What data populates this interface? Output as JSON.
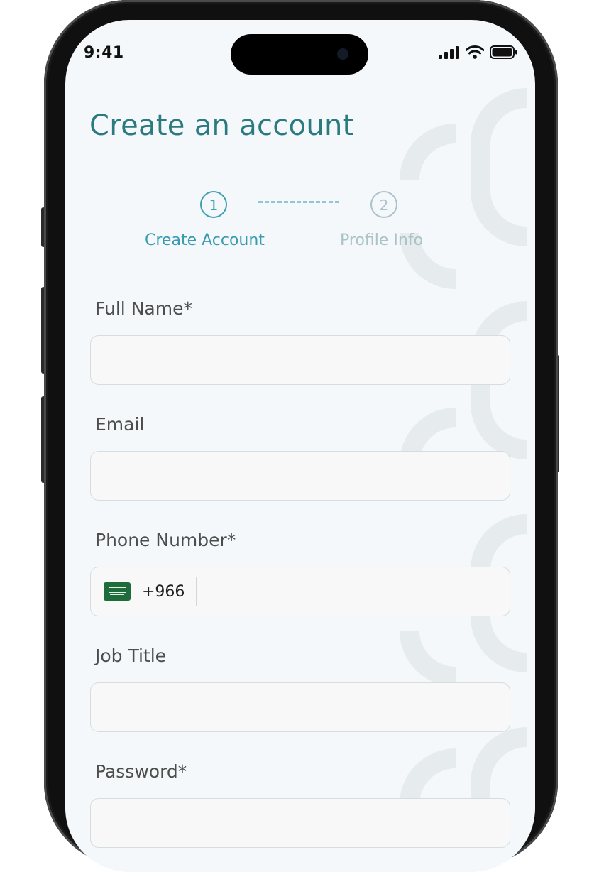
{
  "status_bar": {
    "time": "9:41"
  },
  "page": {
    "title": "Create an account"
  },
  "stepper": {
    "steps": [
      {
        "number": "1",
        "label": "Create Account",
        "state": "active"
      },
      {
        "number": "2",
        "label": "Profile Info",
        "state": "inactive"
      }
    ]
  },
  "form": {
    "full_name": {
      "label": "Full Name*",
      "value": "",
      "placeholder": ""
    },
    "email": {
      "label": "Email",
      "value": "",
      "placeholder": ""
    },
    "phone": {
      "label": "Phone Number*",
      "country_flag": "saudi-arabia-flag-icon",
      "dial_code": "+966",
      "value": "",
      "placeholder": ""
    },
    "job_title": {
      "label": "Job Title",
      "value": "",
      "placeholder": ""
    },
    "password": {
      "label": "Password*",
      "value": "",
      "placeholder": ""
    }
  },
  "colors": {
    "accent": "#2a7a80",
    "step_active": "#3fa0b4",
    "step_inactive": "#a9c3c9",
    "background": "#f4f8fa",
    "input_background": "#f8f8f8"
  }
}
